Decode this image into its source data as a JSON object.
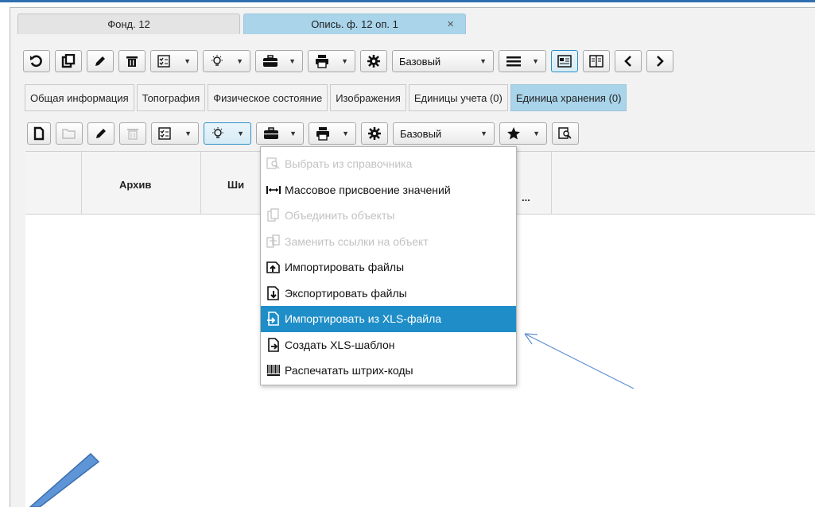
{
  "doc_tabs": [
    {
      "label": "Фонд. 12"
    },
    {
      "label": "Опись. ф. 12 оп. 1",
      "close": "×"
    }
  ],
  "toolbar_main": {
    "preset_select": "Базовый"
  },
  "section_tabs": [
    {
      "label": "Общая информация"
    },
    {
      "label": "Топография"
    },
    {
      "label": "Физическое состояние"
    },
    {
      "label": "Изображения"
    },
    {
      "label": "Единицы учета (0)"
    },
    {
      "label": "Единица хранения (0)"
    }
  ],
  "toolbar_sub": {
    "preset_select": "Базовый"
  },
  "table": {
    "columns": [
      "Архив",
      "Ши",
      "..."
    ]
  },
  "menu": {
    "items": [
      {
        "label": "Выбрать из справочника",
        "icon": "search-doc-icon",
        "enabled": false
      },
      {
        "label": "Массовое присвоение значений",
        "icon": "mass-assign-icon",
        "enabled": true
      },
      {
        "label": "Объединить объекты",
        "icon": "merge-icon",
        "enabled": false
      },
      {
        "label": "Заменить ссылки на объект",
        "icon": "replace-links-icon",
        "enabled": false
      },
      {
        "label": "Импортировать файлы",
        "icon": "import-files-icon",
        "enabled": true
      },
      {
        "label": "Экспортировать файлы",
        "icon": "export-files-icon",
        "enabled": true
      },
      {
        "label": "Импортировать из XLS-файла",
        "icon": "import-xls-icon",
        "enabled": true,
        "highlighted": true
      },
      {
        "label": "Создать XLS-шаблон",
        "icon": "xls-template-icon",
        "enabled": true
      },
      {
        "label": "Распечатать штрих-коды",
        "icon": "barcode-icon",
        "enabled": true
      }
    ]
  },
  "colors": {
    "active_tab": "#a9d4ea",
    "highlight": "#1f8ec8",
    "annotation_arrow": "#5b8fd0"
  }
}
